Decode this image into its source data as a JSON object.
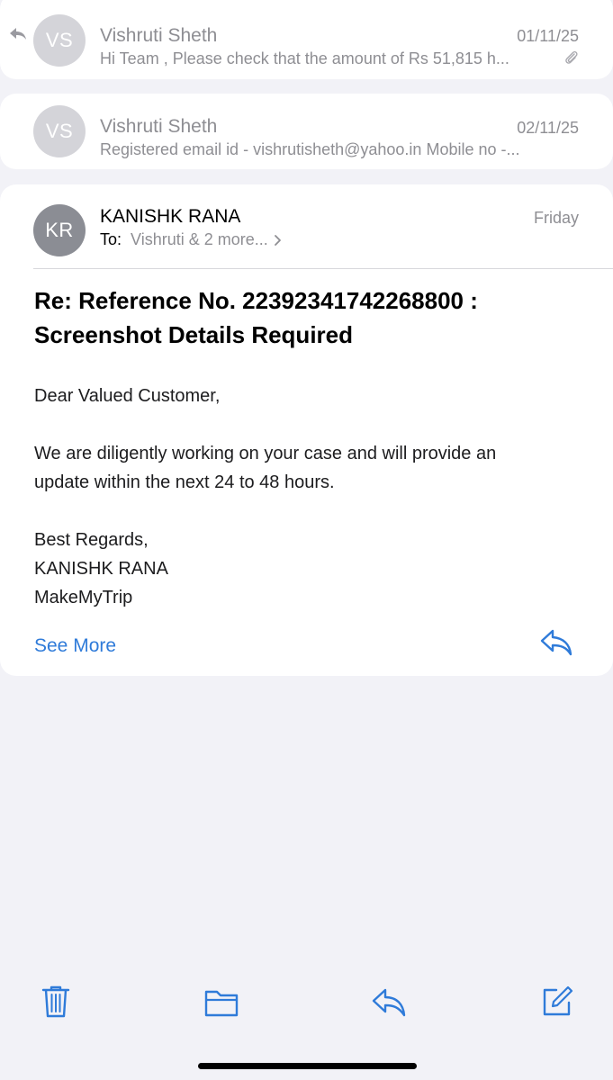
{
  "colors": {
    "accent": "#2f7bd9",
    "secondary_text": "#8e8e93",
    "page_bg": "#f2f2f7",
    "avatar_light": "#d4d4d9",
    "avatar_dark": "#8b8d94"
  },
  "thread": [
    {
      "initials": "VS",
      "sender": "Vishruti Sheth",
      "date": "01/11/25",
      "preview": "Hi Team , Please check that the amount of Rs 51,815 h...",
      "replied": true,
      "has_attachment": true
    },
    {
      "initials": "VS",
      "sender": "Vishruti Sheth",
      "date": "02/11/25",
      "preview": "Registered email id - vishrutisheth@yahoo.in Mobile no -...",
      "replied": false,
      "has_attachment": false
    }
  ],
  "open_message": {
    "initials": "KR",
    "sender": "KANISHK RANA",
    "date": "Friday",
    "to_label": "To:",
    "recipients": "Vishruti & 2 more...",
    "subject_line1": "Re: Reference No. 22392341742268800 :",
    "subject_line2": "Screenshot Details Required",
    "greeting": "Dear Valued Customer,",
    "body_line1": "We are diligently working on your case and will provide an",
    "body_line2": "update within the next 24 to 48 hours.",
    "signoff": "Best Regards,",
    "signature_name": "KANISHK RANA",
    "signature_company": "MakeMyTrip",
    "see_more": "See More"
  },
  "toolbar": {
    "icons": [
      "trash-icon",
      "folder-icon",
      "reply-icon",
      "compose-icon"
    ]
  }
}
